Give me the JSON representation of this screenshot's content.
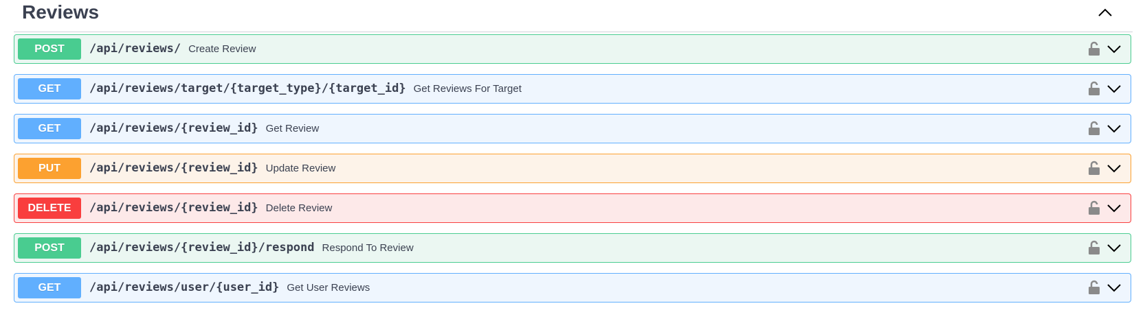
{
  "section": {
    "title": "Reviews",
    "collapse_icon": "chevron-up-icon"
  },
  "operations": [
    {
      "method": "POST",
      "path": "/api/reviews/",
      "summary": "Create Review"
    },
    {
      "method": "GET",
      "path": "/api/reviews/target/{target_type}/{target_id}",
      "summary": "Get Reviews For Target"
    },
    {
      "method": "GET",
      "path": "/api/reviews/{review_id}",
      "summary": "Get Review"
    },
    {
      "method": "PUT",
      "path": "/api/reviews/{review_id}",
      "summary": "Update Review"
    },
    {
      "method": "DELETE",
      "path": "/api/reviews/{review_id}",
      "summary": "Delete Review"
    },
    {
      "method": "POST",
      "path": "/api/reviews/{review_id}/respond",
      "summary": "Respond To Review"
    },
    {
      "method": "GET",
      "path": "/api/reviews/user/{user_id}",
      "summary": "Get User Reviews"
    }
  ],
  "icons": {
    "lock": "unlocked-padlock-icon",
    "expand": "chevron-down-icon"
  },
  "colors": {
    "post": "#49cc90",
    "get": "#61affe",
    "put": "#fca130",
    "delete": "#f93e3e",
    "text": "#3b4151"
  }
}
